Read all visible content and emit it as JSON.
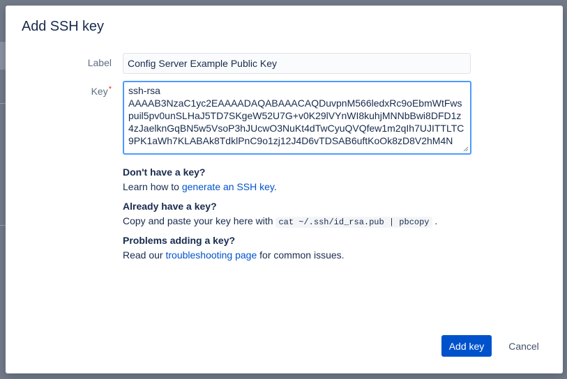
{
  "dialog": {
    "title": "Add SSH key"
  },
  "form": {
    "label_field": {
      "label": "Label",
      "value": "Config Server Example Public Key"
    },
    "key_field": {
      "label": "Key",
      "required_marker": "*",
      "value": "ssh-rsa\nAAAAB3NzaC1yc2EAAAADAQABAAACAQDuvpnM566ledxRc9oEbmWtFwspuil5pv0unSLHaJ5TD7SKgeW52U7G+v0K29lVYnWI8kuhjMNNbBwi8DFD1z4zJaelknGqBN5w5VsoP3hJUcwO3NuKt4dTwCyuQVQfew1m2qIh7UJITTLTC9PK1aWh7KLABAk8TdklPnC9o1zj12J4D6vTDSAB6uftKoOk8zD8V2hM4N"
    }
  },
  "help": {
    "no_key": {
      "heading": "Don't have a key?",
      "text_before": "Learn how to ",
      "link": "generate an SSH key",
      "text_after": "."
    },
    "have_key": {
      "heading": "Already have a key?",
      "text_before": "Copy and paste your key here with ",
      "code": "cat ~/.ssh/id_rsa.pub | pbcopy",
      "text_after": " ."
    },
    "problems": {
      "heading": "Problems adding a key?",
      "text_before": "Read our ",
      "link": "troubleshooting page",
      "text_after": " for common issues."
    }
  },
  "actions": {
    "add_label": "Add key",
    "cancel_label": "Cancel"
  },
  "colors": {
    "primary": "#0052cc",
    "link": "#0052cc",
    "focus_border": "#4c9aff",
    "required": "#de350b",
    "text": "#172b4d",
    "label": "#5e6c84"
  }
}
